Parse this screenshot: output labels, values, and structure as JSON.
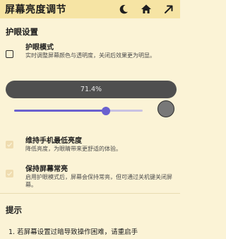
{
  "header": {
    "title": "屏幕亮度调节",
    "icons": [
      "moon-icon",
      "home-icon",
      "arrow-up-right-icon"
    ]
  },
  "eye_section": {
    "title": "护眼设置",
    "eye_mode": {
      "title": "护眼模式",
      "description": "实时调整屏幕颜色与透明度，关闭后效果更为明显。",
      "checked": false
    },
    "level_label": "71.4%",
    "slider_value": 0.714,
    "keep_min_brightness": {
      "title": "维持手机最低亮度",
      "description": "降低亮度，为眼睛带来更舒适的体验。",
      "checked": true,
      "enabled": false
    },
    "keep_screen_on": {
      "title": "保持屏幕常亮",
      "description": "启用护眼模式后，屏幕会保持常亮，但可通过关机键关闭屏幕。",
      "checked": true,
      "enabled": false
    }
  },
  "tips": {
    "title": "提示",
    "item1": "1. 若屏幕设置过暗导致操作困难，请重启手"
  },
  "colors": {
    "app_bar": "#f6e4a4",
    "background": "#fbf3d6",
    "slider_accent": "#6a61cf",
    "pill": "#4f4f4f"
  }
}
